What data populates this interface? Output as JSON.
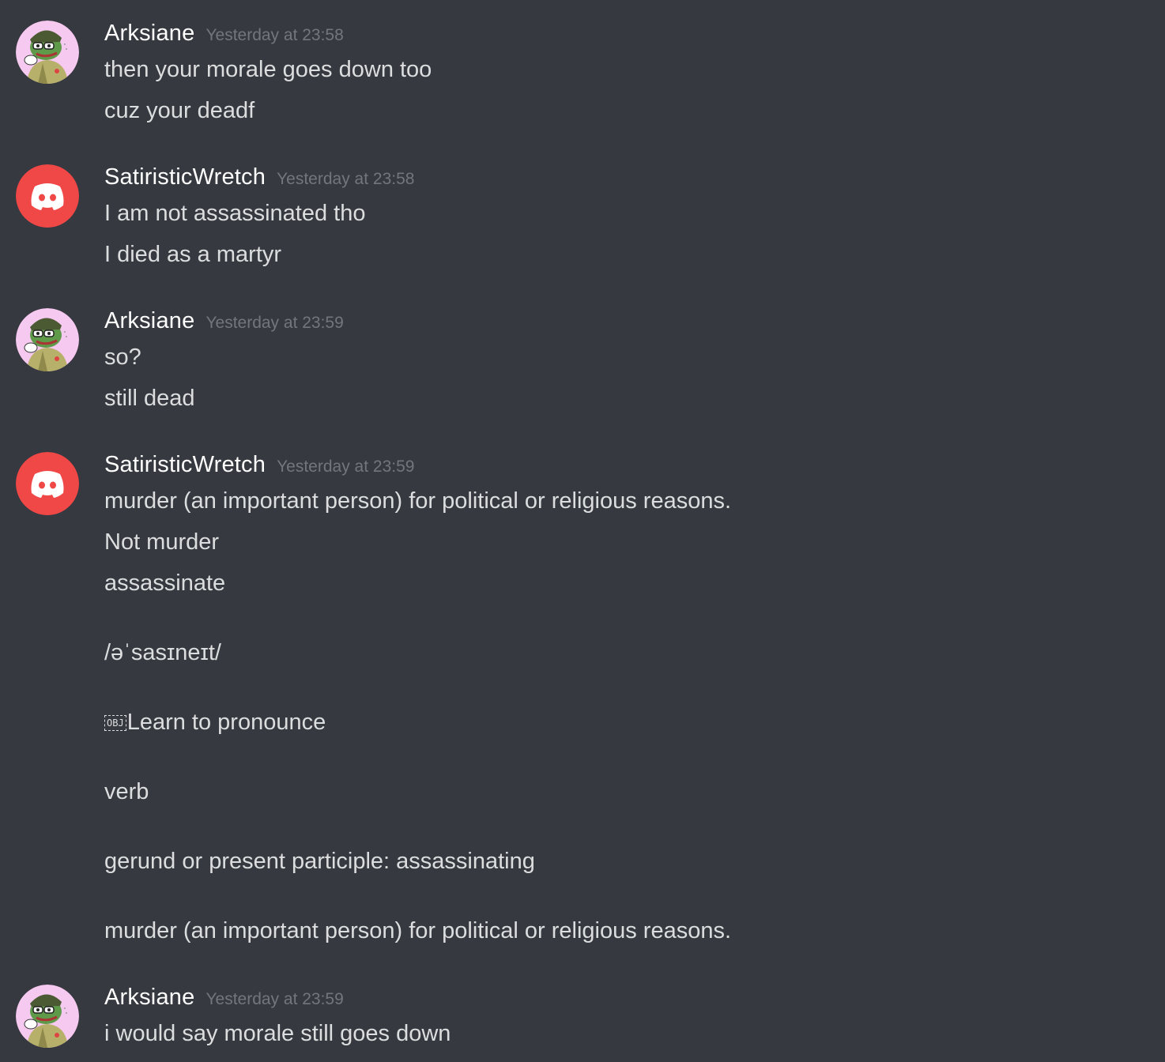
{
  "messages": [
    {
      "username": "Arksiane",
      "timestamp": "Yesterday at 23:58",
      "avatar": "frog-soldier-avatar",
      "lines": [
        "then your morale goes down too",
        "cuz your deadf"
      ]
    },
    {
      "username": "SatiristicWretch",
      "timestamp": "Yesterday at 23:58",
      "avatar": "discord-default-avatar",
      "avatar_color": "#f04747",
      "lines": [
        "I am not assassinated tho",
        "I died as a martyr"
      ]
    },
    {
      "username": "Arksiane",
      "timestamp": "Yesterday at 23:59",
      "avatar": "frog-soldier-avatar",
      "lines": [
        "so?",
        "still dead"
      ]
    },
    {
      "username": "SatiristicWretch",
      "timestamp": "Yesterday at 23:59",
      "avatar": "discord-default-avatar",
      "avatar_color": "#f04747",
      "lines": [
        "murder (an important person) for political or religious reasons.",
        "Not murder",
        "assassinate",
        "/əˈsasɪneɪt/",
        "Learn to pronounce",
        "verb",
        "gerund or present participle: assassinating",
        "murder (an important person) for political or religious reasons."
      ],
      "obj_glyph": "OBJ"
    },
    {
      "username": "Arksiane",
      "timestamp": "Yesterday at 23:59",
      "avatar": "frog-soldier-avatar",
      "lines": [
        "i would say morale still goes down"
      ]
    }
  ],
  "colors": {
    "background": "#36393f",
    "username": "#ffffff",
    "timestamp": "#72767d",
    "text": "#dcddde"
  }
}
